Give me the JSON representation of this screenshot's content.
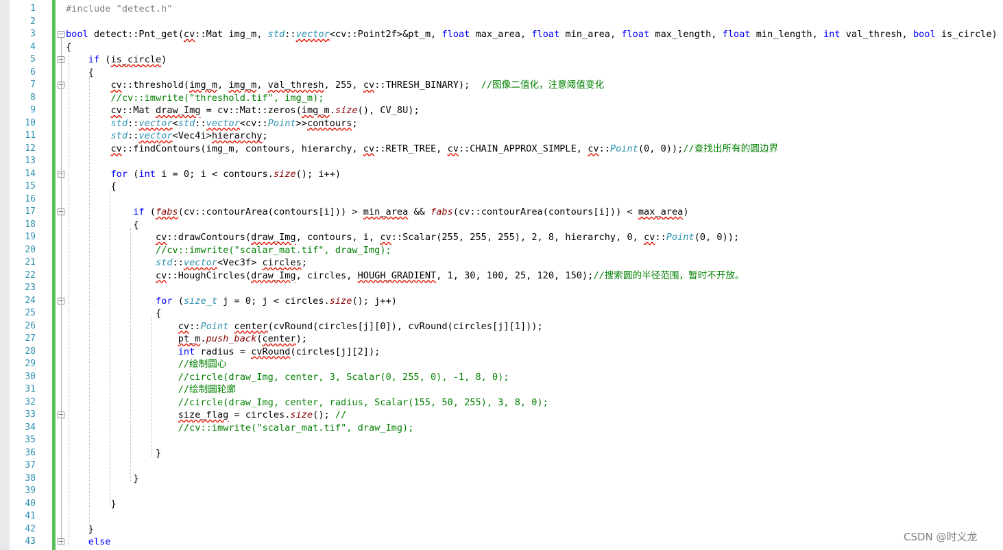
{
  "editor": {
    "language": "C++",
    "colors": {
      "keyword": "#0000ff",
      "type": "#2b91af",
      "comment": "#008000",
      "string": "#a31515",
      "line_number": "#2b91af",
      "change_bar": "#57c057",
      "squiggle": "#e51400"
    },
    "lines": [
      {
        "n": "1",
        "tokens": [
          {
            "t": "#include \"detect.h\"",
            "c": "pp"
          }
        ]
      },
      {
        "n": "2",
        "tokens": []
      },
      {
        "n": "3",
        "tokens": [
          {
            "t": "bool",
            "c": "kw"
          },
          {
            "t": " detect::Pnt_get("
          },
          {
            "t": "cv",
            "c": "sq"
          },
          {
            "t": "::Mat img_m, "
          },
          {
            "t": "std",
            "c": "ty"
          },
          {
            "t": "::"
          },
          {
            "t": "vector",
            "c": "ty sq"
          },
          {
            "t": "<cv::Point2f>&pt_m, "
          },
          {
            "t": "float",
            "c": "kw"
          },
          {
            "t": " max_area, "
          },
          {
            "t": "float",
            "c": "kw"
          },
          {
            "t": " min_area, "
          },
          {
            "t": "float",
            "c": "kw"
          },
          {
            "t": " max_length, "
          },
          {
            "t": "float",
            "c": "kw"
          },
          {
            "t": " min_length, "
          },
          {
            "t": "int",
            "c": "kw"
          },
          {
            "t": " val_thresh, "
          },
          {
            "t": "bool",
            "c": "kw"
          },
          {
            "t": " is_circle)"
          }
        ]
      },
      {
        "n": "4",
        "tokens": [
          {
            "t": "{"
          }
        ]
      },
      {
        "n": "5",
        "tokens": [
          {
            "t": "    "
          },
          {
            "t": "if",
            "c": "kw"
          },
          {
            "t": " ("
          },
          {
            "t": "is_circle",
            "c": "sq"
          },
          {
            "t": ")"
          }
        ]
      },
      {
        "n": "6",
        "tokens": [
          {
            "t": "    {"
          }
        ]
      },
      {
        "n": "7",
        "tokens": [
          {
            "t": "        "
          },
          {
            "t": "cv",
            "c": "sq"
          },
          {
            "t": "::threshold("
          },
          {
            "t": "img_m",
            "c": "sq"
          },
          {
            "t": ", "
          },
          {
            "t": "img_m",
            "c": "sq"
          },
          {
            "t": ", "
          },
          {
            "t": "val_thresh",
            "c": "sq"
          },
          {
            "t": ", 255, "
          },
          {
            "t": "cv",
            "c": "sq"
          },
          {
            "t": "::THRESH_BINARY);  "
          },
          {
            "t": "//图像二值化，注意阈值变化",
            "c": "cm"
          }
        ]
      },
      {
        "n": "8",
        "tokens": [
          {
            "t": "        "
          },
          {
            "t": "//cv::imwrite(\"threshold.tif\", img_m);",
            "c": "cm"
          }
        ]
      },
      {
        "n": "9",
        "tokens": [
          {
            "t": "        "
          },
          {
            "t": "cv",
            "c": "sq"
          },
          {
            "t": "::Mat "
          },
          {
            "t": "draw_Img",
            "c": "sq"
          },
          {
            "t": " = cv::Mat::zeros("
          },
          {
            "t": "img_m",
            "c": "sq"
          },
          {
            "t": "."
          },
          {
            "t": "size",
            "c": "fn"
          },
          {
            "t": "(), CV_8U);"
          }
        ]
      },
      {
        "n": "10",
        "tokens": [
          {
            "t": "        "
          },
          {
            "t": "std",
            "c": "ty"
          },
          {
            "t": "::"
          },
          {
            "t": "vector",
            "c": "ty sq"
          },
          {
            "t": "<"
          },
          {
            "t": "std",
            "c": "ty"
          },
          {
            "t": "::"
          },
          {
            "t": "vector",
            "c": "ty sq"
          },
          {
            "t": "<cv::"
          },
          {
            "t": "Point",
            "c": "ty"
          },
          {
            "t": ">>"
          },
          {
            "t": "contours",
            "c": "sq"
          },
          {
            "t": ";"
          }
        ]
      },
      {
        "n": "11",
        "tokens": [
          {
            "t": "        "
          },
          {
            "t": "std",
            "c": "ty"
          },
          {
            "t": "::"
          },
          {
            "t": "vector",
            "c": "ty sq"
          },
          {
            "t": "<Vec4i>"
          },
          {
            "t": "hierarchy",
            "c": "sq"
          },
          {
            "t": ";"
          }
        ]
      },
      {
        "n": "12",
        "tokens": [
          {
            "t": "        "
          },
          {
            "t": "cv",
            "c": "sq"
          },
          {
            "t": "::findContours(img_m, contours, hierarchy, "
          },
          {
            "t": "cv",
            "c": "sq"
          },
          {
            "t": "::RETR_TREE, "
          },
          {
            "t": "cv",
            "c": "sq"
          },
          {
            "t": "::CHAIN_APPROX_SIMPLE, "
          },
          {
            "t": "cv",
            "c": "sq"
          },
          {
            "t": "::"
          },
          {
            "t": "Point",
            "c": "ty"
          },
          {
            "t": "(0, 0));"
          },
          {
            "t": "//查找出所有的圆边界",
            "c": "cm"
          }
        ]
      },
      {
        "n": "13",
        "tokens": []
      },
      {
        "n": "14",
        "tokens": [
          {
            "t": "        "
          },
          {
            "t": "for",
            "c": "kw"
          },
          {
            "t": " ("
          },
          {
            "t": "int",
            "c": "kw"
          },
          {
            "t": " i = 0; i < contours."
          },
          {
            "t": "size",
            "c": "fn"
          },
          {
            "t": "(); i++)"
          }
        ]
      },
      {
        "n": "15",
        "tokens": [
          {
            "t": "        {"
          }
        ]
      },
      {
        "n": "16",
        "tokens": []
      },
      {
        "n": "17",
        "tokens": [
          {
            "t": "            "
          },
          {
            "t": "if",
            "c": "kw"
          },
          {
            "t": " ("
          },
          {
            "t": "fabs",
            "c": "fn sq"
          },
          {
            "t": "(cv::contourArea(contours[i])) > "
          },
          {
            "t": "min_area",
            "c": "sq"
          },
          {
            "t": " && "
          },
          {
            "t": "fabs",
            "c": "fn"
          },
          {
            "t": "(cv::contourArea(contours[i])) < "
          },
          {
            "t": "max_area",
            "c": "sq"
          },
          {
            "t": ")"
          }
        ]
      },
      {
        "n": "18",
        "tokens": [
          {
            "t": "            {"
          }
        ]
      },
      {
        "n": "19",
        "tokens": [
          {
            "t": "                "
          },
          {
            "t": "cv",
            "c": "sq"
          },
          {
            "t": "::drawContours("
          },
          {
            "t": "draw_Img",
            "c": "sq"
          },
          {
            "t": ", contours, i, "
          },
          {
            "t": "cv",
            "c": "sq"
          },
          {
            "t": "::Scalar(255, 255, 255), 2, 8, hierarchy, 0, "
          },
          {
            "t": "cv",
            "c": "sq"
          },
          {
            "t": "::"
          },
          {
            "t": "Point",
            "c": "ty"
          },
          {
            "t": "(0, 0));"
          }
        ]
      },
      {
        "n": "20",
        "tokens": [
          {
            "t": "                "
          },
          {
            "t": "//cv::imwrite(\"scalar_mat.tif\", draw_Img);",
            "c": "cm"
          }
        ]
      },
      {
        "n": "21",
        "tokens": [
          {
            "t": "                "
          },
          {
            "t": "std",
            "c": "ty"
          },
          {
            "t": "::"
          },
          {
            "t": "vector",
            "c": "ty sq"
          },
          {
            "t": "<Vec3f> "
          },
          {
            "t": "circles",
            "c": "sq"
          },
          {
            "t": ";"
          }
        ]
      },
      {
        "n": "22",
        "tokens": [
          {
            "t": "                "
          },
          {
            "t": "cv",
            "c": "sq"
          },
          {
            "t": "::HoughCircles("
          },
          {
            "t": "draw_Img",
            "c": "sq"
          },
          {
            "t": ", circles, "
          },
          {
            "t": "HOUGH_GRADIENT",
            "c": "sq"
          },
          {
            "t": ", 1, 30, 100, 25, 120, 150);"
          },
          {
            "t": "//搜索圆的半径范围，暂时不开放。",
            "c": "cm"
          }
        ]
      },
      {
        "n": "23",
        "tokens": []
      },
      {
        "n": "24",
        "tokens": [
          {
            "t": "                "
          },
          {
            "t": "for",
            "c": "kw"
          },
          {
            "t": " ("
          },
          {
            "t": "size_t",
            "c": "ty"
          },
          {
            "t": " j = 0; j < circles."
          },
          {
            "t": "size",
            "c": "fn"
          },
          {
            "t": "(); j++)"
          }
        ]
      },
      {
        "n": "25",
        "tokens": [
          {
            "t": "                {"
          }
        ]
      },
      {
        "n": "26",
        "tokens": [
          {
            "t": "                    "
          },
          {
            "t": "cv",
            "c": "sq"
          },
          {
            "t": "::"
          },
          {
            "t": "Point",
            "c": "ty"
          },
          {
            "t": " "
          },
          {
            "t": "center",
            "c": "sq"
          },
          {
            "t": "(cvRound(circles[j][0]), cvRound(circles[j][1]));"
          }
        ]
      },
      {
        "n": "27",
        "tokens": [
          {
            "t": "                    "
          },
          {
            "t": "pt_m",
            "c": "sq"
          },
          {
            "t": "."
          },
          {
            "t": "push_back",
            "c": "fn"
          },
          {
            "t": "("
          },
          {
            "t": "center",
            "c": "sq"
          },
          {
            "t": ");"
          }
        ]
      },
      {
        "n": "28",
        "tokens": [
          {
            "t": "                    "
          },
          {
            "t": "int",
            "c": "kw"
          },
          {
            "t": " radius = "
          },
          {
            "t": "cvRound",
            "c": "sq"
          },
          {
            "t": "(circles[j][2]);"
          }
        ]
      },
      {
        "n": "29",
        "tokens": [
          {
            "t": "                    "
          },
          {
            "t": "//绘制圆心",
            "c": "cm"
          }
        ]
      },
      {
        "n": "30",
        "tokens": [
          {
            "t": "                    "
          },
          {
            "t": "//circle(draw_Img, center, 3, Scalar(0, 255, 0), -1, 8, 0);",
            "c": "cm"
          }
        ]
      },
      {
        "n": "31",
        "tokens": [
          {
            "t": "                    "
          },
          {
            "t": "//绘制圆轮廓",
            "c": "cm"
          }
        ]
      },
      {
        "n": "32",
        "tokens": [
          {
            "t": "                    "
          },
          {
            "t": "//circle(draw_Img, center, radius, Scalar(155, 50, 255), 3, 8, 0);",
            "c": "cm"
          }
        ]
      },
      {
        "n": "33",
        "tokens": [
          {
            "t": "                    "
          },
          {
            "t": "size_flag",
            "c": "sq"
          },
          {
            "t": " = circles."
          },
          {
            "t": "size",
            "c": "fn"
          },
          {
            "t": "(); "
          },
          {
            "t": "//",
            "c": "cm"
          }
        ]
      },
      {
        "n": "34",
        "tokens": [
          {
            "t": "                    "
          },
          {
            "t": "//cv::imwrite(\"scalar_mat.tif\", draw_Img);",
            "c": "cm"
          }
        ]
      },
      {
        "n": "35",
        "tokens": []
      },
      {
        "n": "36",
        "tokens": [
          {
            "t": "                }"
          }
        ]
      },
      {
        "n": "37",
        "tokens": []
      },
      {
        "n": "38",
        "tokens": [
          {
            "t": "            }"
          }
        ]
      },
      {
        "n": "39",
        "tokens": []
      },
      {
        "n": "40",
        "tokens": [
          {
            "t": "        }"
          }
        ]
      },
      {
        "n": "41",
        "tokens": []
      },
      {
        "n": "42",
        "tokens": [
          {
            "t": "    }"
          }
        ]
      },
      {
        "n": "43",
        "tokens": [
          {
            "t": "    "
          },
          {
            "t": "else",
            "c": "kw"
          }
        ]
      }
    ]
  },
  "watermark": "CSDN @时义龙"
}
